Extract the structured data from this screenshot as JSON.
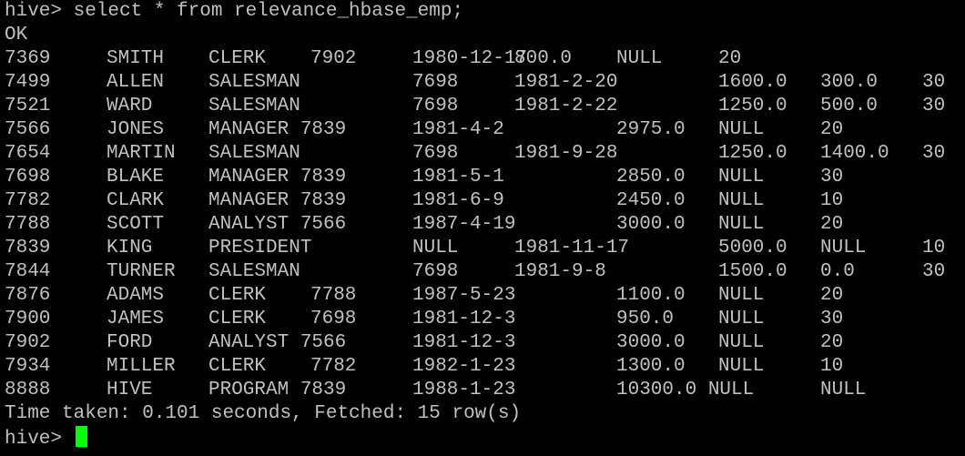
{
  "terminal": {
    "command_line": "hive> select * from relevance_hbase_emp;",
    "status": "OK",
    "rows": [
      [
        "7369",
        "SMITH",
        "CLERK",
        "7902",
        "1980-12-17",
        "800.0",
        "NULL",
        "20",
        "",
        ""
      ],
      [
        "7499",
        "ALLEN",
        "SALESMAN",
        "",
        "7698",
        "1981-2-20",
        "",
        "1600.0",
        "300.0",
        "30"
      ],
      [
        "7521",
        "WARD",
        "SALESMAN",
        "",
        "7698",
        "1981-2-22",
        "",
        "1250.0",
        "500.0",
        "30"
      ],
      [
        "7566",
        "JONES",
        "MANAGER 7839",
        "",
        "1981-4-2",
        "",
        "2975.0",
        "NULL",
        "20",
        ""
      ],
      [
        "7654",
        "MARTIN",
        "SALESMAN",
        "",
        "7698",
        "1981-9-28",
        "",
        "1250.0",
        "1400.0",
        "30"
      ],
      [
        "7698",
        "BLAKE",
        "MANAGER 7839",
        "",
        "1981-5-1",
        "",
        "2850.0",
        "NULL",
        "30",
        ""
      ],
      [
        "7782",
        "CLARK",
        "MANAGER 7839",
        "",
        "1981-6-9",
        "",
        "2450.0",
        "NULL",
        "10",
        ""
      ],
      [
        "7788",
        "SCOTT",
        "ANALYST 7566",
        "",
        "1987-4-19",
        "",
        "3000.0",
        "NULL",
        "20",
        ""
      ],
      [
        "7839",
        "KING",
        "PRESIDENT",
        "",
        "NULL",
        "1981-11-17",
        "",
        "5000.0",
        "NULL",
        "10"
      ],
      [
        "7844",
        "TURNER",
        "SALESMAN",
        "",
        "7698",
        "1981-9-8",
        "",
        "1500.0",
        "0.0",
        "30"
      ],
      [
        "7876",
        "ADAMS",
        "CLERK",
        "7788",
        "1987-5-23",
        "",
        "1100.0",
        "NULL",
        "20",
        ""
      ],
      [
        "7900",
        "JAMES",
        "CLERK",
        "7698",
        "1981-12-3",
        "",
        "950.0",
        "NULL",
        "30",
        ""
      ],
      [
        "7902",
        "FORD",
        "ANALYST 7566",
        "",
        "1981-12-3",
        "",
        "3000.0",
        "NULL",
        "20",
        ""
      ],
      [
        "7934",
        "MILLER",
        "CLERK",
        "7782",
        "1982-1-23",
        "",
        "1300.0",
        "NULL",
        "10",
        ""
      ],
      [
        "8888",
        "HIVE",
        "PROGRAM 7839",
        "",
        "1988-1-23",
        "",
        "10300.0 NULL",
        "",
        "NULL",
        ""
      ]
    ],
    "summary": "Time taken: 0.101 seconds, Fetched: 15 row(s)",
    "prompt": "hive> "
  },
  "colors": {
    "background": "#000000",
    "text": "#c0c0c0",
    "cursor": "#00ff00"
  }
}
